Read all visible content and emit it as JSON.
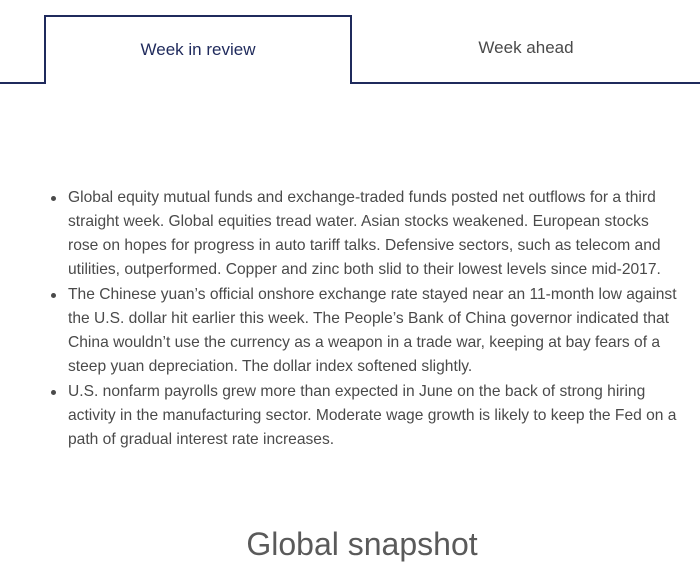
{
  "tabs": {
    "items": [
      {
        "label": "Week in review",
        "active": true
      },
      {
        "label": "Week ahead",
        "active": false
      }
    ]
  },
  "review": {
    "bullets": [
      "Global equity mutual funds and exchange-traded funds posted net outflows for a third straight week. Global equities tread water. Asian stocks weakened. European stocks rose on hopes for progress in auto tariff talks. Defensive sectors, such as telecom and utilities, outperformed. Copper and zinc both slid to their lowest levels since mid-2017.",
      "The Chinese yuan’s official onshore exchange rate stayed near an 11-month low against the U.S. dollar hit earlier this week. The People’s Bank of China governor indicated that China wouldn’t use the currency as a weapon in a trade war, keeping at bay fears of a steep yuan depreciation. The dollar index softened slightly.",
      "U.S. nonfarm payrolls grew more than expected in June on the back of strong hiring activity in the manufacturing sector. Moderate wage growth is likely to keep the Fed on a path of gradual interest rate increases."
    ]
  },
  "section": {
    "title": "Global snapshot"
  },
  "colors": {
    "accent": "#1f2a5c",
    "text": "#4a4a4a"
  }
}
